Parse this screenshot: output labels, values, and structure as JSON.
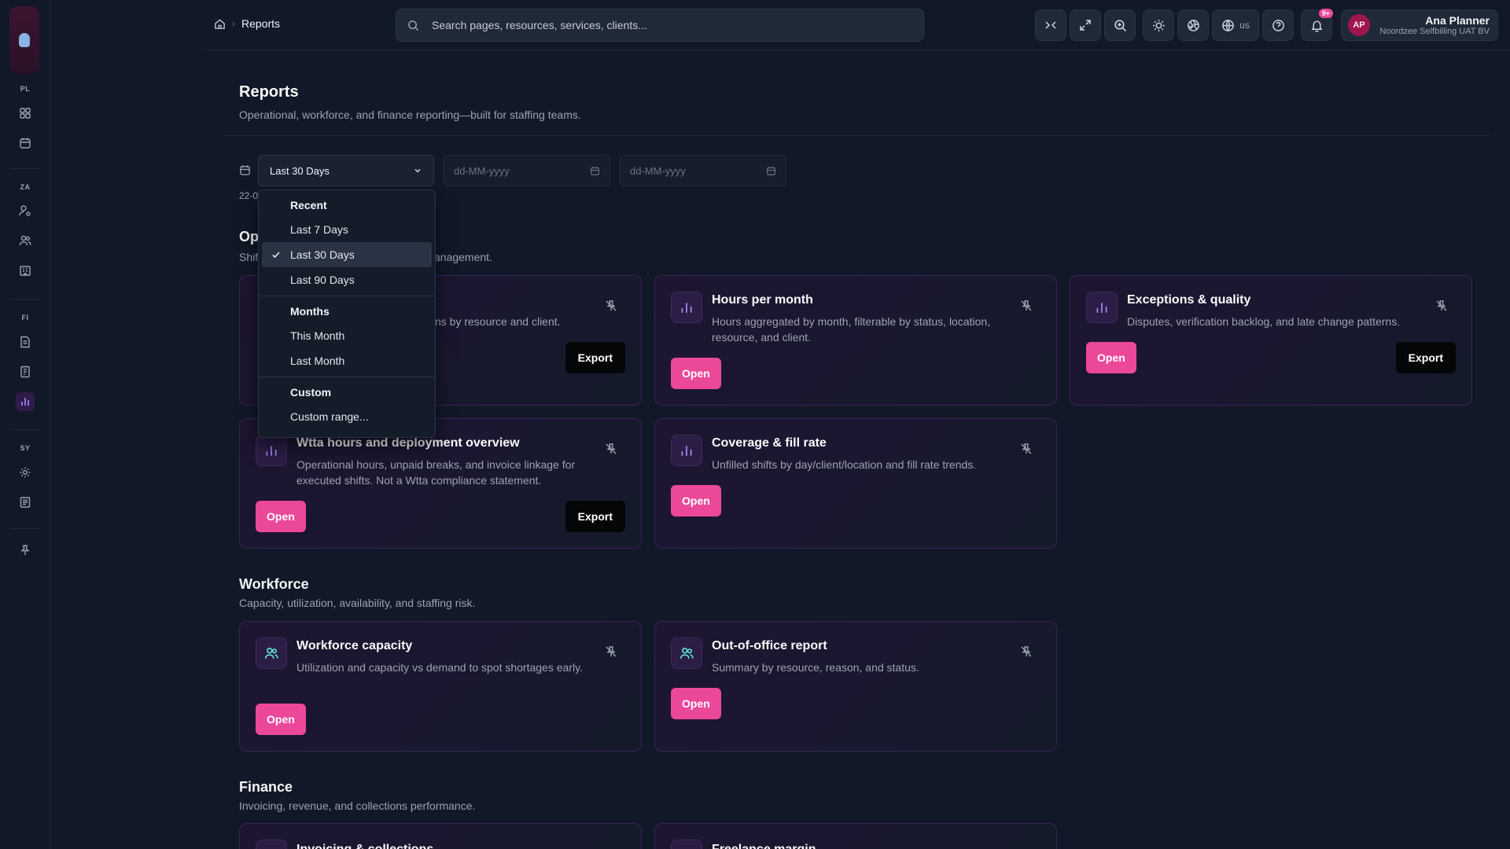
{
  "sidebar": {
    "sections": [
      {
        "label": "PL",
        "icons": [
          "dashboard-icon",
          "calendar-icon"
        ]
      },
      {
        "label": "ZA",
        "icons": [
          "user-cog-icon",
          "users-icon",
          "building-icon"
        ]
      },
      {
        "label": "FI",
        "icons": [
          "invoice-icon",
          "receipt-icon",
          "chart-icon"
        ]
      },
      {
        "label": "SY",
        "icons": [
          "settings-icon",
          "logs-icon"
        ]
      }
    ]
  },
  "header": {
    "breadcrumb_current": "Reports",
    "search_placeholder": "Search pages, resources, services, clients...",
    "language": "us",
    "notifications_badge": "9+",
    "user": {
      "initials": "AP",
      "name": "Ana Planner",
      "org": "Noordzee Selfbilling UAT BV"
    }
  },
  "page": {
    "title": "Reports",
    "subtitle": "Operational, workforce, and finance reporting—built for staffing teams."
  },
  "filters": {
    "range_value": "Last 30 Days",
    "from_placeholder": "dd-MM-yyyy",
    "to_placeholder": "dd-MM-yyyy",
    "range_note": "22-0"
  },
  "dropdown": {
    "groups": [
      {
        "label": "Recent",
        "items": [
          "Last 7 Days",
          "Last 30 Days",
          "Last 90 Days"
        ]
      },
      {
        "label": "Months",
        "items": [
          "This Month",
          "Last Month"
        ]
      },
      {
        "label": "Custom",
        "items": [
          "Custom range..."
        ]
      }
    ],
    "selected": "Last 30 Days"
  },
  "sections": {
    "operations": {
      "title": "Op",
      "subtitle_left": "Shif",
      "subtitle_right": "anagement."
    },
    "workforce": {
      "title": "Workforce",
      "subtitle": "Capacity, utilization, availability, and staffing risk."
    },
    "finance": {
      "title": "Finance",
      "subtitle": "Invoicing, revenue, and collections performance."
    }
  },
  "cards": {
    "ops_first": {
      "desc": "ns by resource and client.",
      "export": "Export"
    },
    "hours_per_month": {
      "title": "Hours per month",
      "desc": "Hours aggregated by month, filterable by status, location, resource, and client.",
      "open": "Open"
    },
    "exceptions": {
      "title": "Exceptions & quality",
      "desc": "Disputes, verification backlog, and late change patterns.",
      "open": "Open",
      "export": "Export"
    },
    "wtta": {
      "title": "Wtta hours and deployment overview",
      "desc": "Operational hours, unpaid breaks, and invoice linkage for executed shifts. Not a Wtta compliance statement.",
      "open": "Open",
      "export": "Export"
    },
    "coverage": {
      "title": "Coverage & fill rate",
      "desc": "Unfilled shifts by day/client/location and fill rate trends.",
      "open": "Open"
    },
    "workforce_capacity": {
      "title": "Workforce capacity",
      "desc": "Utilization and capacity vs demand to spot shortages early.",
      "open": "Open"
    },
    "out_of_office": {
      "title": "Out-of-office report",
      "desc": "Summary by resource, reason, and status.",
      "open": "Open"
    },
    "invoicing": {
      "title": "Invoicing & collections"
    },
    "freelance": {
      "title": "Freelance margin"
    }
  },
  "colors": {
    "accent": "#ec4899",
    "bg": "#111827",
    "card_border": "#3b2456",
    "icon_purple": "#a78bfa",
    "icon_teal": "#5eead4"
  }
}
